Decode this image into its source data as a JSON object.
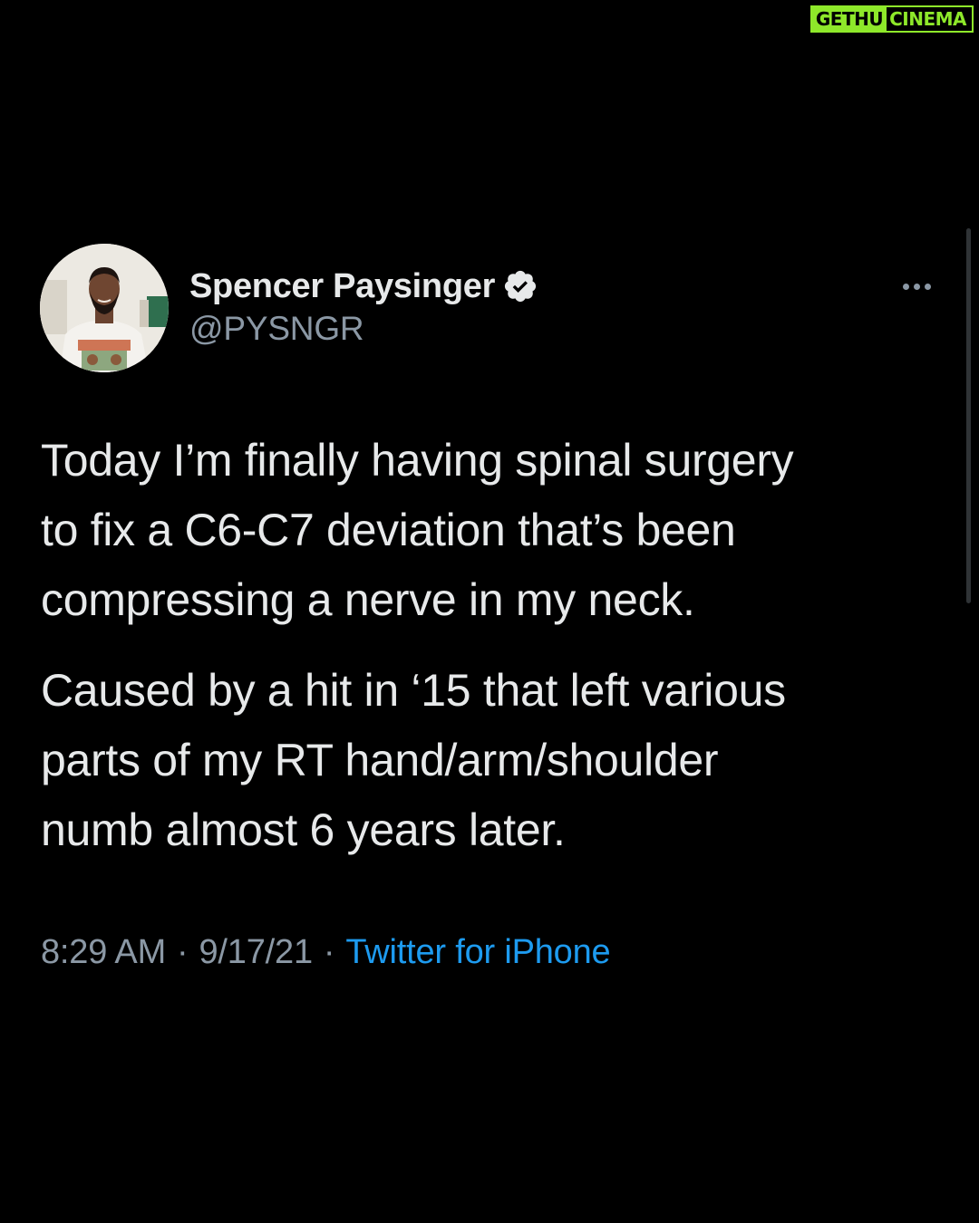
{
  "watermark": {
    "left": "GETHU",
    "right": "CINEMA",
    "color": "#8ee82a"
  },
  "tweet": {
    "author": {
      "display_name": "Spencer Paysinger",
      "handle": "@PYSNGR",
      "verified": true,
      "verified_color": "#e7e9ea"
    },
    "more_icon": "ellipsis-icon",
    "paragraphs": [
      [
        "Today I’m finally having spinal surgery",
        "to fix a C6-C7 deviation that’s been",
        "compressing a nerve in my neck."
      ],
      [
        "Caused by a hit in ‘15 that left various",
        "parts of my RT hand/arm/shoulder",
        "numb almost 6 years later."
      ]
    ],
    "time": "8:29 AM",
    "separator": "·",
    "date": "9/17/21",
    "source": "Twitter for iPhone"
  },
  "colors": {
    "background": "#000000",
    "text": "#e7e9ea",
    "secondary": "#8b98a5",
    "link": "#1d9bf0"
  }
}
